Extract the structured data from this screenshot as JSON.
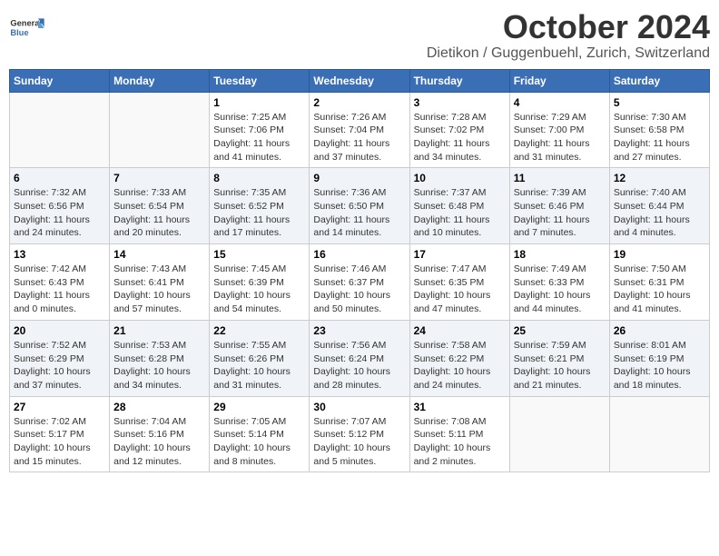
{
  "header": {
    "logo_general": "General",
    "logo_blue": "Blue",
    "month": "October 2024",
    "location": "Dietikon / Guggenbuehl, Zurich, Switzerland"
  },
  "weekdays": [
    "Sunday",
    "Monday",
    "Tuesday",
    "Wednesday",
    "Thursday",
    "Friday",
    "Saturday"
  ],
  "weeks": [
    [
      {
        "day": "",
        "info": ""
      },
      {
        "day": "",
        "info": ""
      },
      {
        "day": "1",
        "info": "Sunrise: 7:25 AM\nSunset: 7:06 PM\nDaylight: 11 hours and 41 minutes."
      },
      {
        "day": "2",
        "info": "Sunrise: 7:26 AM\nSunset: 7:04 PM\nDaylight: 11 hours and 37 minutes."
      },
      {
        "day": "3",
        "info": "Sunrise: 7:28 AM\nSunset: 7:02 PM\nDaylight: 11 hours and 34 minutes."
      },
      {
        "day": "4",
        "info": "Sunrise: 7:29 AM\nSunset: 7:00 PM\nDaylight: 11 hours and 31 minutes."
      },
      {
        "day": "5",
        "info": "Sunrise: 7:30 AM\nSunset: 6:58 PM\nDaylight: 11 hours and 27 minutes."
      }
    ],
    [
      {
        "day": "6",
        "info": "Sunrise: 7:32 AM\nSunset: 6:56 PM\nDaylight: 11 hours and 24 minutes."
      },
      {
        "day": "7",
        "info": "Sunrise: 7:33 AM\nSunset: 6:54 PM\nDaylight: 11 hours and 20 minutes."
      },
      {
        "day": "8",
        "info": "Sunrise: 7:35 AM\nSunset: 6:52 PM\nDaylight: 11 hours and 17 minutes."
      },
      {
        "day": "9",
        "info": "Sunrise: 7:36 AM\nSunset: 6:50 PM\nDaylight: 11 hours and 14 minutes."
      },
      {
        "day": "10",
        "info": "Sunrise: 7:37 AM\nSunset: 6:48 PM\nDaylight: 11 hours and 10 minutes."
      },
      {
        "day": "11",
        "info": "Sunrise: 7:39 AM\nSunset: 6:46 PM\nDaylight: 11 hours and 7 minutes."
      },
      {
        "day": "12",
        "info": "Sunrise: 7:40 AM\nSunset: 6:44 PM\nDaylight: 11 hours and 4 minutes."
      }
    ],
    [
      {
        "day": "13",
        "info": "Sunrise: 7:42 AM\nSunset: 6:43 PM\nDaylight: 11 hours and 0 minutes."
      },
      {
        "day": "14",
        "info": "Sunrise: 7:43 AM\nSunset: 6:41 PM\nDaylight: 10 hours and 57 minutes."
      },
      {
        "day": "15",
        "info": "Sunrise: 7:45 AM\nSunset: 6:39 PM\nDaylight: 10 hours and 54 minutes."
      },
      {
        "day": "16",
        "info": "Sunrise: 7:46 AM\nSunset: 6:37 PM\nDaylight: 10 hours and 50 minutes."
      },
      {
        "day": "17",
        "info": "Sunrise: 7:47 AM\nSunset: 6:35 PM\nDaylight: 10 hours and 47 minutes."
      },
      {
        "day": "18",
        "info": "Sunrise: 7:49 AM\nSunset: 6:33 PM\nDaylight: 10 hours and 44 minutes."
      },
      {
        "day": "19",
        "info": "Sunrise: 7:50 AM\nSunset: 6:31 PM\nDaylight: 10 hours and 41 minutes."
      }
    ],
    [
      {
        "day": "20",
        "info": "Sunrise: 7:52 AM\nSunset: 6:29 PM\nDaylight: 10 hours and 37 minutes."
      },
      {
        "day": "21",
        "info": "Sunrise: 7:53 AM\nSunset: 6:28 PM\nDaylight: 10 hours and 34 minutes."
      },
      {
        "day": "22",
        "info": "Sunrise: 7:55 AM\nSunset: 6:26 PM\nDaylight: 10 hours and 31 minutes."
      },
      {
        "day": "23",
        "info": "Sunrise: 7:56 AM\nSunset: 6:24 PM\nDaylight: 10 hours and 28 minutes."
      },
      {
        "day": "24",
        "info": "Sunrise: 7:58 AM\nSunset: 6:22 PM\nDaylight: 10 hours and 24 minutes."
      },
      {
        "day": "25",
        "info": "Sunrise: 7:59 AM\nSunset: 6:21 PM\nDaylight: 10 hours and 21 minutes."
      },
      {
        "day": "26",
        "info": "Sunrise: 8:01 AM\nSunset: 6:19 PM\nDaylight: 10 hours and 18 minutes."
      }
    ],
    [
      {
        "day": "27",
        "info": "Sunrise: 7:02 AM\nSunset: 5:17 PM\nDaylight: 10 hours and 15 minutes."
      },
      {
        "day": "28",
        "info": "Sunrise: 7:04 AM\nSunset: 5:16 PM\nDaylight: 10 hours and 12 minutes."
      },
      {
        "day": "29",
        "info": "Sunrise: 7:05 AM\nSunset: 5:14 PM\nDaylight: 10 hours and 8 minutes."
      },
      {
        "day": "30",
        "info": "Sunrise: 7:07 AM\nSunset: 5:12 PM\nDaylight: 10 hours and 5 minutes."
      },
      {
        "day": "31",
        "info": "Sunrise: 7:08 AM\nSunset: 5:11 PM\nDaylight: 10 hours and 2 minutes."
      },
      {
        "day": "",
        "info": ""
      },
      {
        "day": "",
        "info": ""
      }
    ]
  ]
}
